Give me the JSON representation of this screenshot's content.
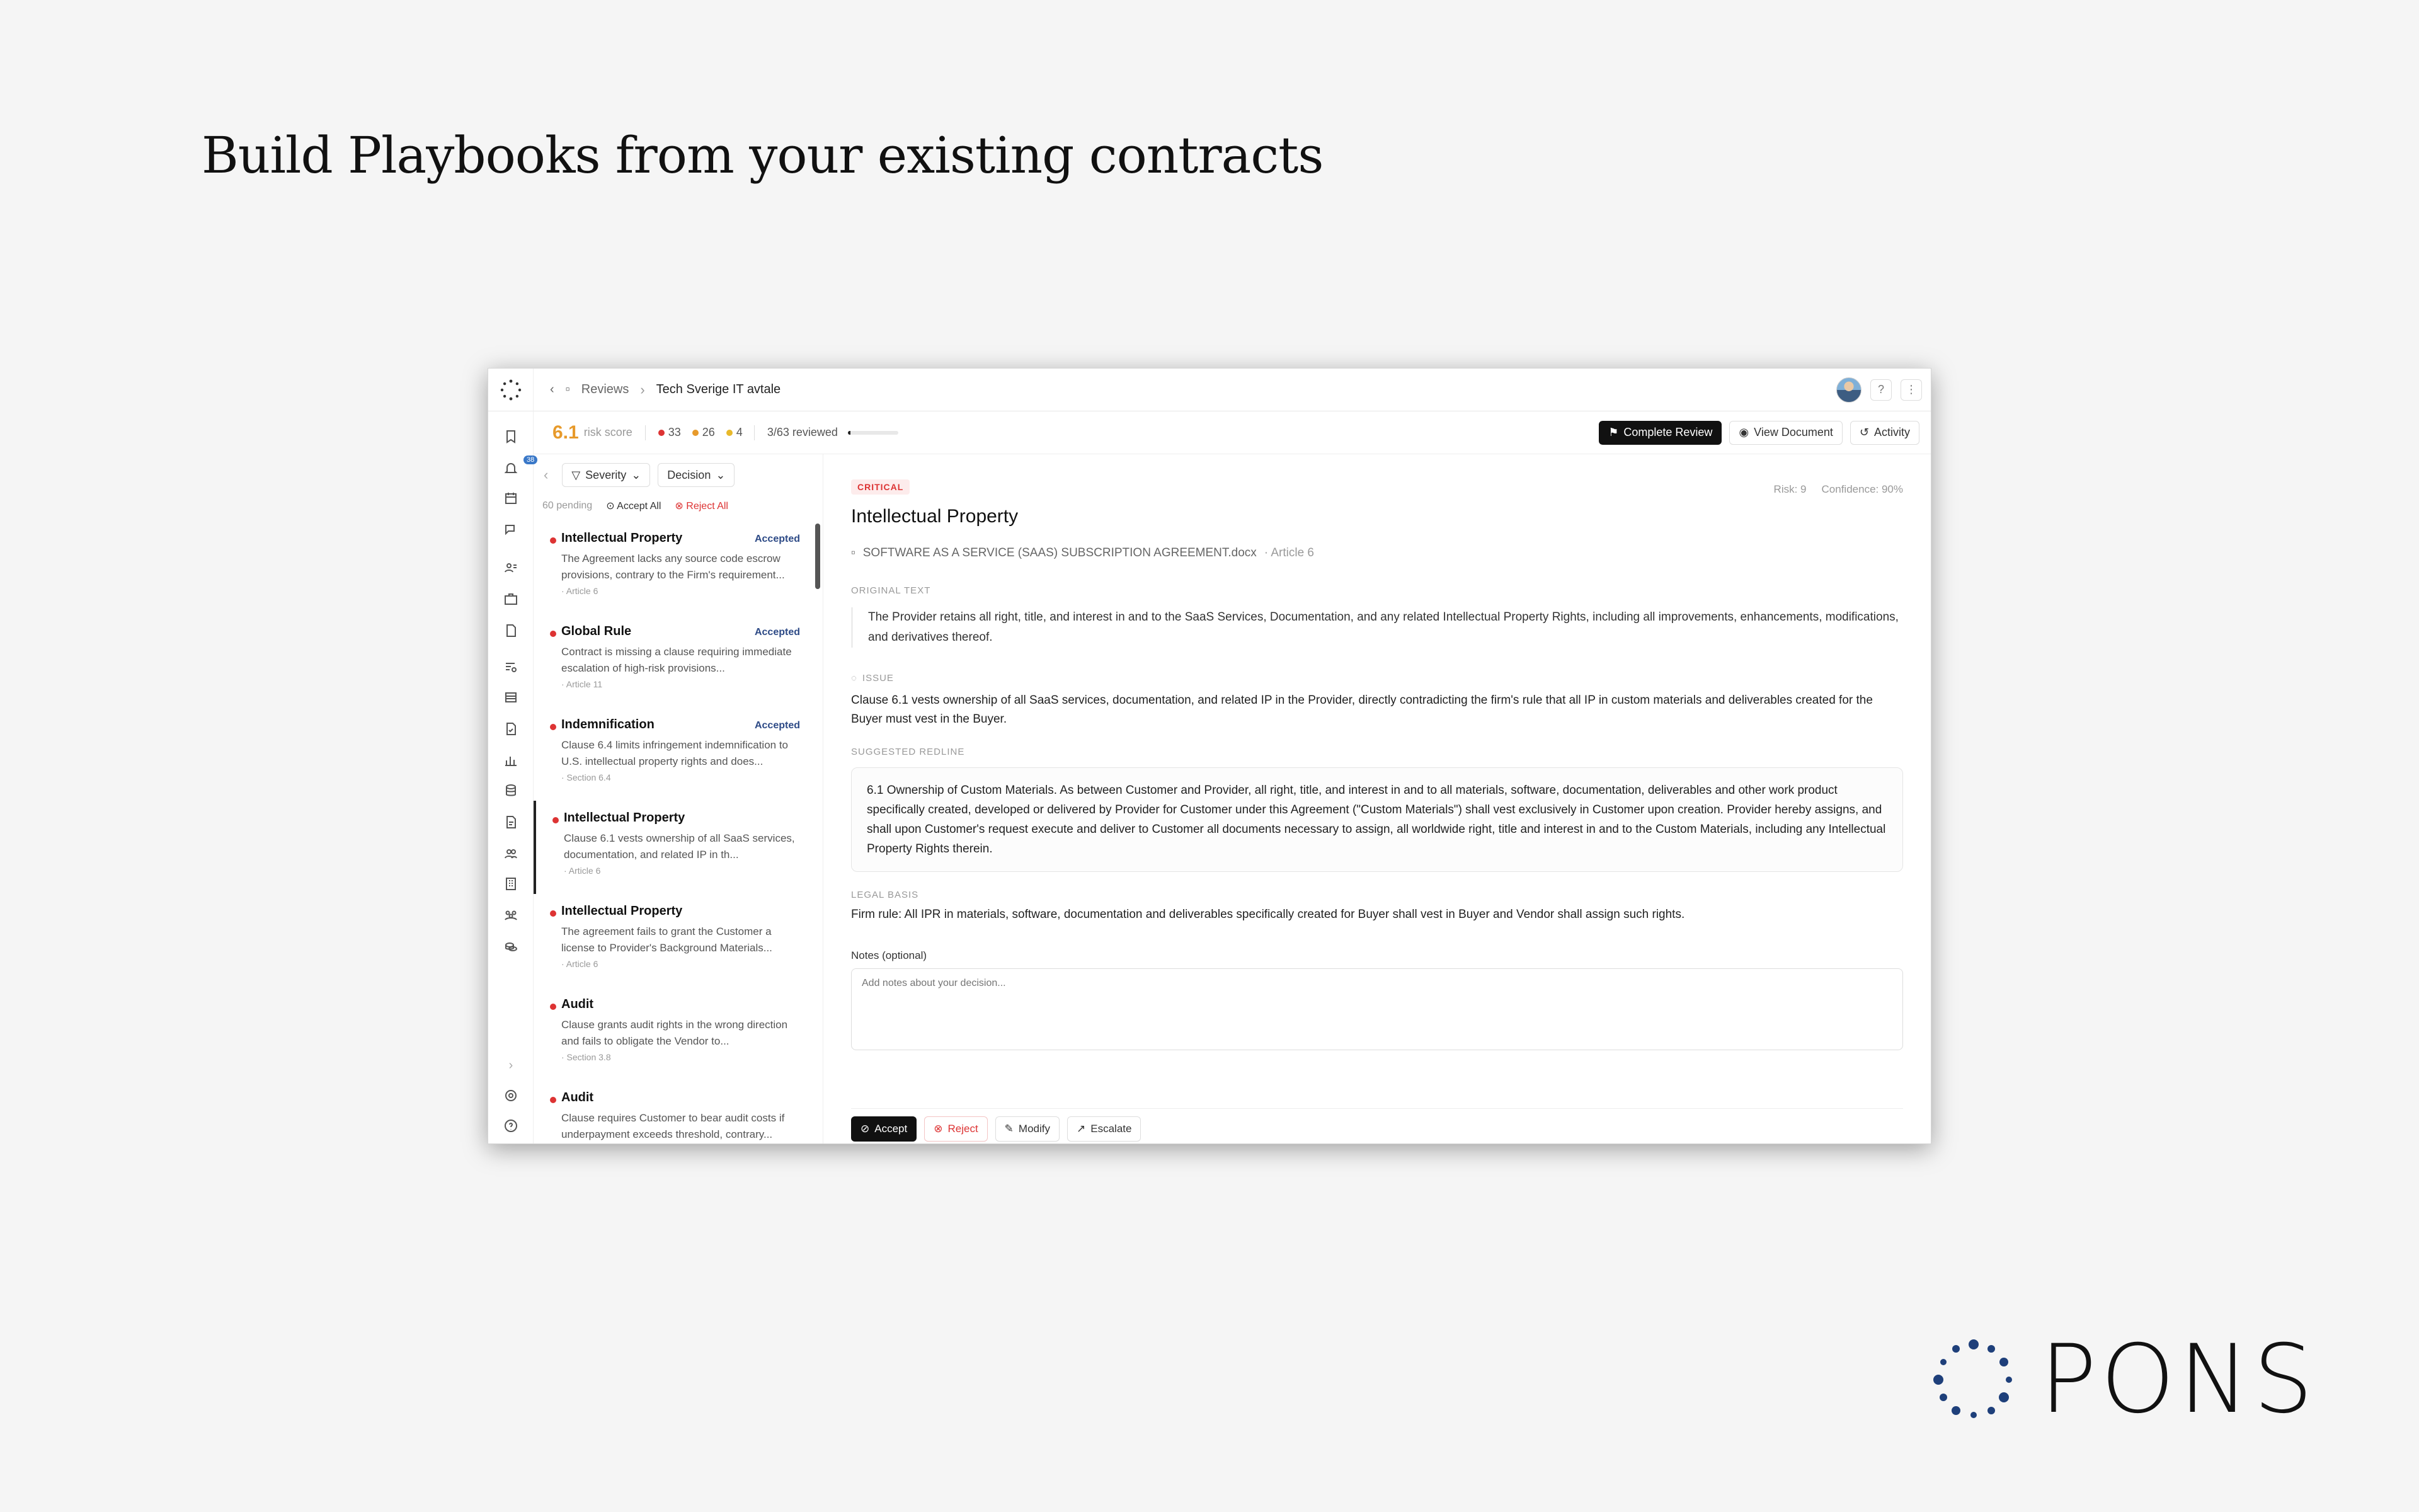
{
  "headline": "Build Playbooks from your existing contracts",
  "brand": {
    "name": "PONS",
    "color": "#1e3f7a"
  },
  "topbar": {
    "crumb_root": "Reviews",
    "crumb_current": "Tech Sverige IT avtale"
  },
  "rail": {
    "notification_badge": "38"
  },
  "stats": {
    "risk_score": "6.1",
    "risk_label": "risk score",
    "high": "33",
    "medium": "26",
    "low": "4",
    "reviewed": "3/63 reviewed",
    "reviewed_fraction": 0.048,
    "complete_label": "Complete Review",
    "view_doc_label": "View Document",
    "activity_label": "Activity"
  },
  "filters": {
    "severity": "Severity",
    "decision": "Decision",
    "pending": "60 pending",
    "accept_all": "Accept All",
    "reject_all": "Reject All"
  },
  "items": [
    {
      "title": "Intellectual Property",
      "status": "Accepted",
      "desc": "The Agreement lacks any source code escrow provisions, contrary to the Firm's requirement...",
      "ref": "· Article 6"
    },
    {
      "title": "Global Rule",
      "status": "Accepted",
      "desc": "Contract is missing a clause requiring immediate escalation of high-risk provisions...",
      "ref": "· Article 11"
    },
    {
      "title": "Indemnification",
      "status": "Accepted",
      "desc": "Clause 6.4 limits infringement indemnification to U.S. intellectual property rights and does...",
      "ref": "· Section 6.4"
    },
    {
      "title": "Intellectual Property",
      "status": "",
      "desc": "Clause 6.1 vests ownership of all SaaS services, documentation, and related IP in th...",
      "ref": "· Article 6"
    },
    {
      "title": "Intellectual Property",
      "status": "",
      "desc": "The agreement fails to grant the Customer a license to Provider's Background Materials...",
      "ref": "· Article 6"
    },
    {
      "title": "Audit",
      "status": "",
      "desc": "Clause grants audit rights in the wrong direction and fails to obligate the Vendor to...",
      "ref": "· Section 3.8"
    },
    {
      "title": "Audit",
      "status": "",
      "desc": "Clause requires Customer to bear audit costs if underpayment exceeds threshold, contrary...",
      "ref": ""
    }
  ],
  "detail": {
    "severity": "CRITICAL",
    "risk": "Risk: 9",
    "confidence": "Confidence: 90%",
    "title": "Intellectual Property",
    "doc": "SOFTWARE AS A SERVICE (SAAS) SUBSCRIPTION AGREEMENT.docx",
    "article": "· Article 6",
    "original_label": "ORIGINAL TEXT",
    "original": "The Provider retains all right, title, and interest in and to the SaaS Services, Documentation, and any related Intellectual Property Rights, including all improvements, enhancements, modifications, and derivatives thereof.",
    "issue_label": "ISSUE",
    "issue": "Clause 6.1 vests ownership of all SaaS services, documentation, and related IP in the Provider, directly contradicting the firm's rule that all IP in custom materials and deliverables created for the Buyer must vest in the Buyer.",
    "redline_label": "SUGGESTED REDLINE",
    "redline": "6.1 Ownership of Custom Materials. As between Customer and Provider, all right, title, and interest in and to all materials, software, documentation, deliverables and other work product specifically created, developed or delivered by Provider for Customer under this Agreement (\"Custom Materials\") shall vest exclusively in Customer upon creation. Provider hereby assigns, and shall upon Customer's request execute and deliver to Customer all documents necessary to assign, all worldwide right, title and interest in and to the Custom Materials, including any Intellectual Property Rights therein.",
    "legal_label": "LEGAL BASIS",
    "legal": "Firm rule: All IPR in materials, software, documentation and deliverables specifically created for Buyer shall vest in Buyer and Vendor shall assign such rights.",
    "notes_label": "Notes (optional)",
    "notes_placeholder": "Add notes about your decision...",
    "accept": "Accept",
    "reject": "Reject",
    "modify": "Modify",
    "escalate": "Escalate"
  }
}
